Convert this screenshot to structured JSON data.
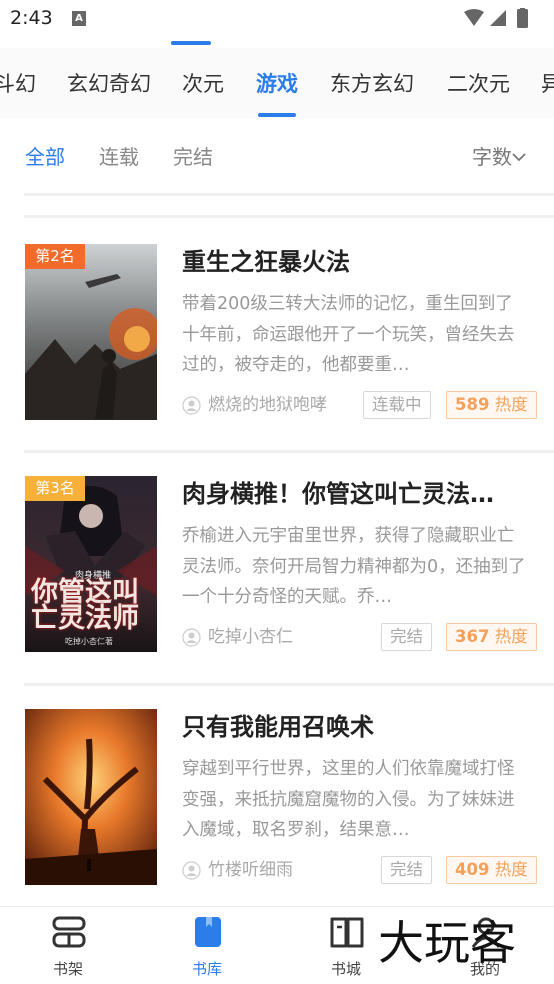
{
  "status_bar": {
    "time": "2:43",
    "notif_icon": "a-icon"
  },
  "categories": [
    {
      "label": "斗幻"
    },
    {
      "label": "玄幻奇幻"
    },
    {
      "label": "次元"
    },
    {
      "label": "游戏",
      "active": true
    },
    {
      "label": "东方玄幻"
    },
    {
      "label": "二次元"
    },
    {
      "label": "异"
    }
  ],
  "filters": {
    "all": "全部",
    "ongoing": "连载",
    "finished": "完结",
    "sort": "字数"
  },
  "books": [
    {
      "rank": "第2名",
      "rank_color": "#f26b2b",
      "title": "重生之狂暴火法",
      "desc": "带着200级三转大法师的记忆，重生回到了十年前，命运跟他开了一个玩笑，曾经失去过的，被夺走的，他都要重…",
      "author": "燃烧的地狱咆哮",
      "status": "连载中",
      "heat_num": "589",
      "heat_label": "热度"
    },
    {
      "rank": "第3名",
      "rank_color": "#f7b13a",
      "title": "肉身横推！你管这叫亡灵法…",
      "desc": "乔榆进入元宇宙里世界，获得了隐藏职业亡灵法师。奈何开局智力精神都为0，还抽到了一个十分奇怪的天赋。乔…",
      "author": "吃掉小杏仁",
      "status": "完结",
      "heat_num": "367",
      "heat_label": "热度",
      "cover_text_top": "肉身横推",
      "cover_text_main": "你管这叫亡灵法师",
      "cover_text_author": "吃掉小杏仁著"
    },
    {
      "rank": "",
      "title": "只有我能用召唤术",
      "desc": "穿越到平行世界，这里的人们依靠魔域打怪变强，来抵抗魔窟魔物的入侵。为了妹妹进入魔域，取名罗刹，结果意…",
      "author": "竹楼听细雨",
      "status": "完结",
      "heat_num": "409",
      "heat_label": "热度"
    }
  ],
  "bottom_nav": [
    {
      "label": "书架",
      "icon": "bookshelf-icon"
    },
    {
      "label": "书库",
      "icon": "library-icon",
      "active": true
    },
    {
      "label": "书城",
      "icon": "open-book-icon"
    },
    {
      "label": "我的",
      "icon": "profile-icon"
    }
  ],
  "watermark": "大玩客",
  "accent_color": "#2b7de9"
}
